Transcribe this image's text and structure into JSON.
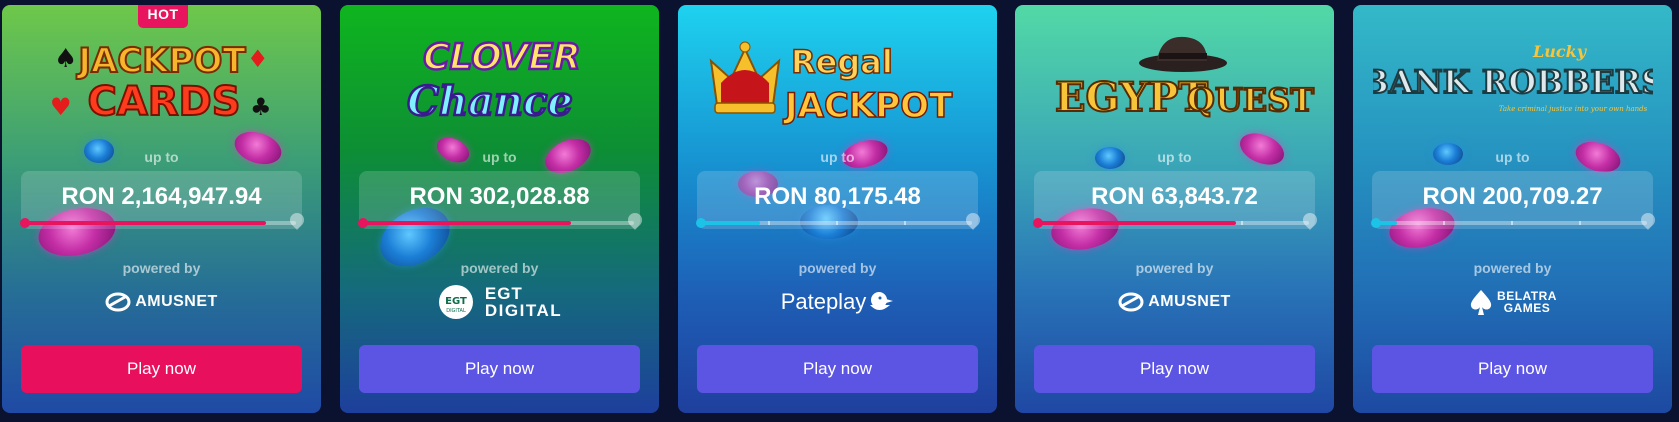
{
  "colors": {
    "hot_badge": "#e8145d",
    "progress_pink": "#e8145d",
    "progress_cyan": "#1cc3e6",
    "button_primary": "#e8105d",
    "button_secondary": "#5c55e4",
    "page_bg": "#0b1230"
  },
  "labels": {
    "up_to": "up to",
    "powered_by": "powered by",
    "play_now": "Play now"
  },
  "cards": [
    {
      "badge": "HOT",
      "game_logo": [
        "JACKPOT",
        "CARDS"
      ],
      "amount": "RON 2,164,947.94",
      "progress": 0.89,
      "progress_color": "pink",
      "provider": "AMUSNET",
      "provider_icon": "amusnet-icon",
      "button_style": "primary"
    },
    {
      "game_logo": [
        "CLOVER",
        "Chance"
      ],
      "amount": "RON 302,028.88",
      "progress": 0.77,
      "progress_color": "pink",
      "provider": [
        "EGT",
        "DIGITAL"
      ],
      "provider_icon_text": [
        "EGT",
        "DIGITAL"
      ],
      "provider_icon": "egt-digital-icon",
      "button_style": "secondary"
    },
    {
      "game_logo": [
        "Regal",
        "JACKPOT"
      ],
      "amount": "RON 80,175.48",
      "progress": 0.22,
      "progress_color": "cyan",
      "provider": "Pateplay",
      "provider_icon": "duck-icon",
      "button_style": "secondary"
    },
    {
      "game_logo": [
        "EGYPT",
        "QUEST"
      ],
      "amount": "RON 63,843.72",
      "progress": 0.73,
      "progress_color": "pink",
      "provider": "AMUSNET",
      "provider_icon": "amusnet-icon",
      "button_style": "secondary"
    },
    {
      "game_logo": [
        "Lucky",
        "BANK ROBBERS"
      ],
      "game_logo_tagline": "Take criminal justice into your own hands",
      "amount": "RON 200,709.27",
      "progress": 0.08,
      "progress_color": "cyan",
      "provider": [
        "BELATRA",
        "GAMES"
      ],
      "provider_icon": "belatra-spade-icon",
      "button_style": "secondary"
    }
  ]
}
